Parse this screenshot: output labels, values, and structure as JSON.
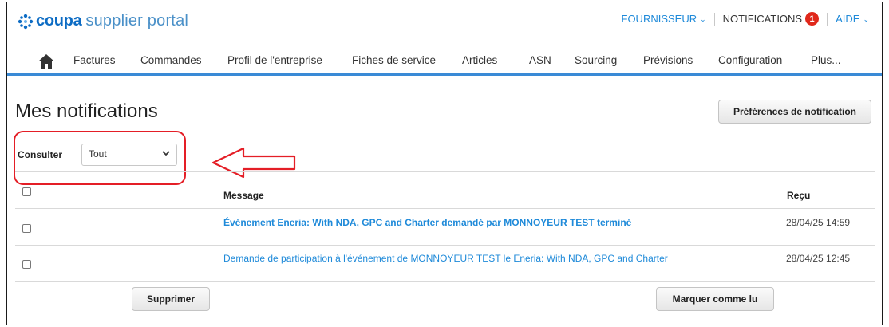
{
  "brand": {
    "name_bold": "coupa",
    "name_rest": "supplier portal"
  },
  "toplinks": {
    "supplier": "FOURNISSEUR",
    "notifications": "NOTIFICATIONS",
    "notifications_count": "1",
    "help": "AIDE"
  },
  "nav": {
    "items": [
      {
        "label": "Factures"
      },
      {
        "label": "Commandes"
      },
      {
        "label": "Profil de l'entreprise"
      },
      {
        "label": "Fiches de service"
      },
      {
        "label": "Articles"
      },
      {
        "label": "ASN"
      },
      {
        "label": "Sourcing"
      },
      {
        "label": "Prévisions"
      },
      {
        "label": "Configuration"
      },
      {
        "label": "Plus..."
      }
    ]
  },
  "page": {
    "title": "Mes notifications",
    "preferences_button": "Préférences de notification"
  },
  "filter": {
    "label": "Consulter",
    "value": "Tout"
  },
  "table": {
    "headers": {
      "message": "Message",
      "received": "Reçu"
    },
    "rows": [
      {
        "message": "Événement Eneria: With NDA, GPC and Charter demandé par MONNOYEUR TEST terminé",
        "received": "28/04/25 14:59",
        "unread": true
      },
      {
        "message": "Demande de participation à l'événement de MONNOYEUR TEST le Eneria: With NDA, GPC and Charter",
        "received": "28/04/25 12:45",
        "unread": false
      }
    ]
  },
  "actions": {
    "delete": "Supprimer",
    "mark_read": "Marquer comme lu"
  },
  "colors": {
    "brand_blue": "#0d6cc4",
    "link_blue": "#1f8ad9",
    "nav_underline": "#3a8ad6",
    "badge_red": "#e0281b",
    "annotation_red": "#e41e26"
  },
  "icons": {
    "logo": "coupa-logo-icon",
    "home": "home-icon",
    "dropdown": "chevron-down-icon",
    "annotation_arrow": "left-arrow-annotation"
  }
}
